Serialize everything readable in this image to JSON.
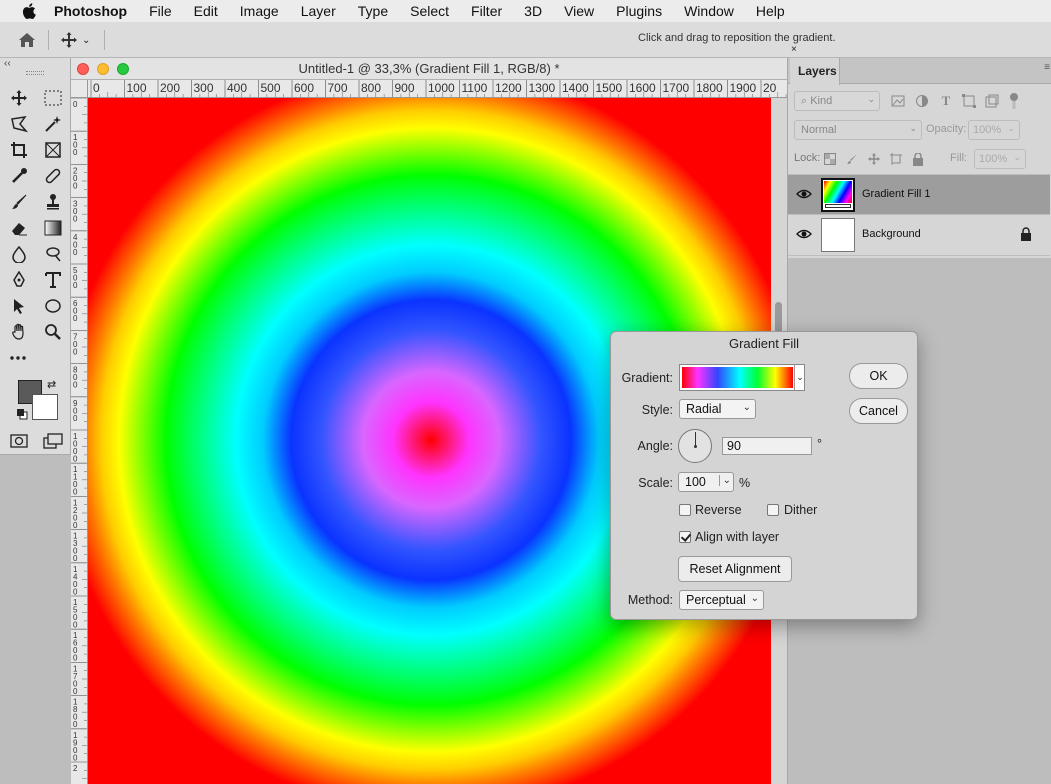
{
  "menubar": {
    "app": "Photoshop",
    "items": [
      "File",
      "Edit",
      "Image",
      "Layer",
      "Type",
      "Select",
      "Filter",
      "3D",
      "View",
      "Plugins",
      "Window",
      "Help"
    ]
  },
  "options": {
    "hint": "Click and drag to reposition the gradient."
  },
  "document": {
    "title": "Untitled-1 @ 33,3% (Gradient Fill 1, RGB/8) *",
    "ruler_h": [
      "0",
      "100",
      "200",
      "300",
      "400",
      "500",
      "600",
      "700",
      "800",
      "900",
      "1000",
      "1100",
      "1200",
      "1300",
      "1400",
      "1500",
      "1600",
      "1700",
      "1800",
      "1900",
      "20"
    ],
    "ruler_v": [
      "0",
      "1\n0\n0",
      "2\n0\n0",
      "3\n0\n0",
      "4\n0\n0",
      "5\n0\n0",
      "6\n0\n0",
      "7\n0\n0",
      "8\n0\n0",
      "9\n0\n0",
      "1\n0\n0\n0",
      "1\n1\n0\n0",
      "1\n2\n0\n0",
      "1\n3\n0\n0",
      "1\n4\n0\n0",
      "1\n5\n0\n0",
      "1\n6\n0\n0",
      "1\n7\n0\n0",
      "1\n8\n0\n0",
      "1\n9\n0\n0",
      "2"
    ]
  },
  "colors": {
    "foreground": "#5a5a5a",
    "background": "#ffffff"
  },
  "layers_panel": {
    "tab": "Layers",
    "kind": "Kind",
    "blend_mode": "Normal",
    "opacity_label": "Opacity:",
    "opacity_value": "100%",
    "lock_label": "Lock:",
    "fill_label": "Fill:",
    "fill_value": "100%",
    "layers": [
      {
        "name": "Gradient Fill 1",
        "selected": true
      },
      {
        "name": "Background",
        "selected": false,
        "locked": true
      }
    ]
  },
  "dialog": {
    "title": "Gradient Fill",
    "gradient_label": "Gradient:",
    "style_label": "Style:",
    "style_value": "Radial",
    "angle_label": "Angle:",
    "angle_value": "90",
    "angle_unit": "°",
    "scale_label": "Scale:",
    "scale_value": "100",
    "scale_unit": "%",
    "reverse_label": "Reverse",
    "reverse_checked": false,
    "dither_label": "Dither",
    "dither_checked": false,
    "align_label": "Align with layer",
    "align_checked": true,
    "reset_label": "Reset Alignment",
    "method_label": "Method:",
    "method_value": "Perceptual",
    "ok_label": "OK",
    "cancel_label": "Cancel"
  }
}
